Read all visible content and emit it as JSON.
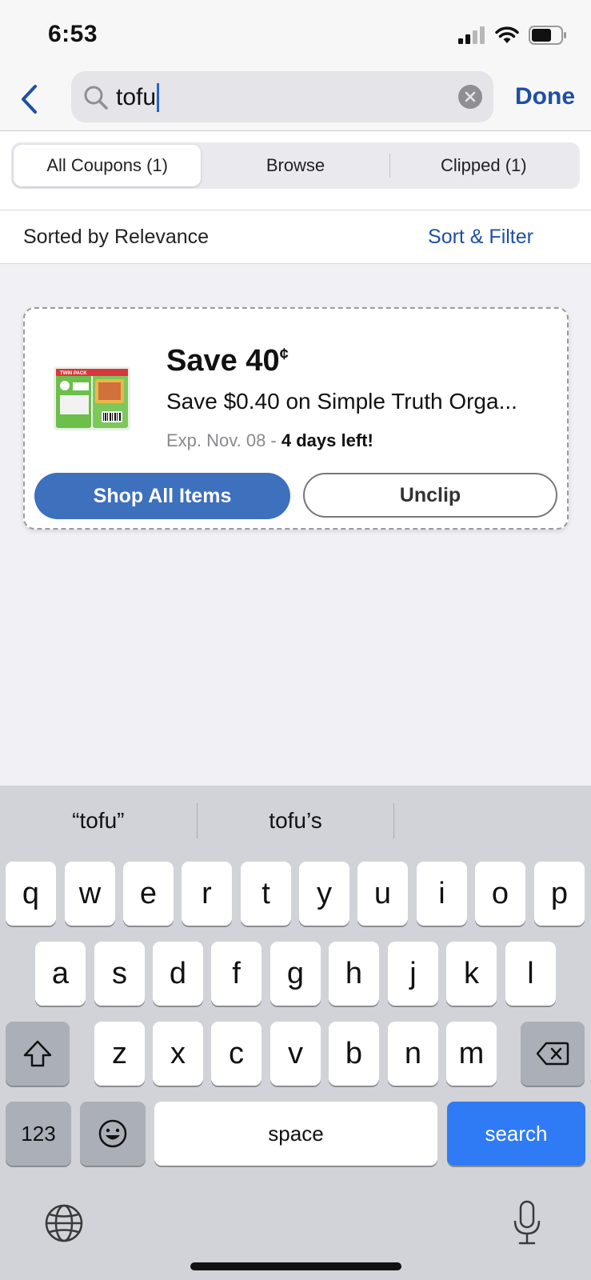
{
  "status": {
    "time": "6:53"
  },
  "search": {
    "query": "tofu",
    "done_label": "Done"
  },
  "tabs": [
    {
      "label": "All Coupons (1)"
    },
    {
      "label": "Browse"
    },
    {
      "label": "Clipped (1)"
    }
  ],
  "sort": {
    "label": "Sorted by Relevance",
    "filter_label": "Sort & Filter"
  },
  "coupon": {
    "title": "Save 40",
    "title_unit": "¢",
    "description": "Save $0.40 on Simple Truth Orga...",
    "expiry_prefix": "Exp. Nov. 08 - ",
    "expiry_highlight": "4 days left!",
    "shop_label": "Shop All Items",
    "unclip_label": "Unclip",
    "product_image_text": "TWIN PACK"
  },
  "keyboard": {
    "suggestions": [
      "“tofu”",
      "tofu’s",
      ""
    ],
    "row1": [
      "q",
      "w",
      "e",
      "r",
      "t",
      "y",
      "u",
      "i",
      "o",
      "p"
    ],
    "row2": [
      "a",
      "s",
      "d",
      "f",
      "g",
      "h",
      "j",
      "k",
      "l"
    ],
    "row3": [
      "z",
      "x",
      "c",
      "v",
      "b",
      "n",
      "m"
    ],
    "numbers_label": "123",
    "space_label": "space",
    "search_label": "search"
  },
  "colors": {
    "accent": "#1f4fa3",
    "shop_button": "#3d70bd",
    "search_key": "#2f7bf5"
  }
}
